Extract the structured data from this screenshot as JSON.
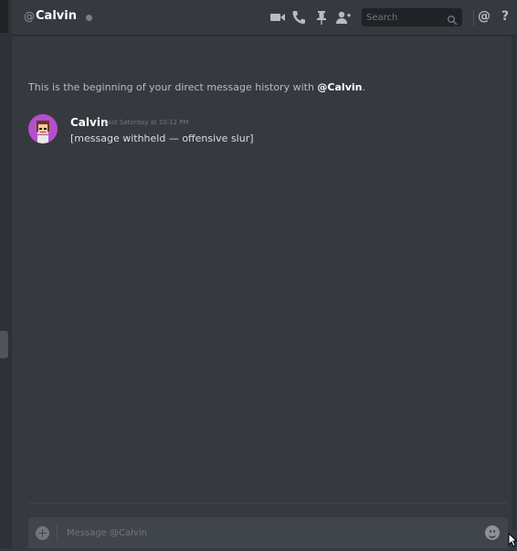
{
  "header": {
    "at_symbol": "@",
    "name": "Calvin",
    "status": "offline",
    "search_placeholder": "Search",
    "mentions_label": "@",
    "help_label": "?",
    "icons": [
      "video-call-icon",
      "voice-call-icon",
      "pin-icon",
      "add-friend-icon",
      "search-icon"
    ]
  },
  "intro": {
    "prefix": "This is the beginning of your direct message history with ",
    "mention": "@Calvin",
    "suffix": "."
  },
  "messages": [
    {
      "author": "Calvin",
      "timestamp": "Last Saturday at 10:12 PM",
      "text": "[message withheld — offensive slur]"
    }
  ],
  "composer": {
    "placeholder": "Message @Calvin"
  },
  "colors": {
    "background": "#36393f",
    "sidebar": "#2f3136",
    "input": "#40444b",
    "avatar": "#b44fcc",
    "status_offline": "#747f8d"
  }
}
